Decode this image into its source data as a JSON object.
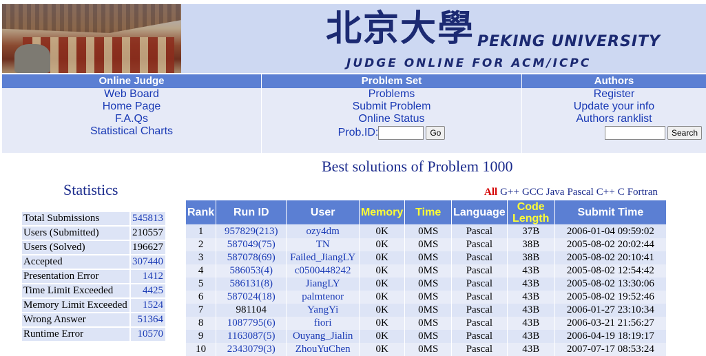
{
  "banner": {
    "chinese": "北京大學",
    "english": "PEKING  UNIVERSITY",
    "subtitle": "JUDGE ONLINE FOR ACM/ICPC"
  },
  "nav": {
    "online_judge": {
      "header": "Online Judge",
      "links": [
        "Web Board",
        "Home Page",
        "F.A.Qs",
        "Statistical Charts"
      ]
    },
    "problem_set": {
      "header": "Problem Set",
      "links": [
        "Problems",
        "Submit Problem",
        "Online Status"
      ],
      "probid_label": "Prob.ID:",
      "go_label": "Go"
    },
    "authors": {
      "header": "Authors",
      "links": [
        "Register",
        "Update your info",
        "Authors ranklist"
      ],
      "search_label": "Search"
    }
  },
  "title": {
    "text": "Best solutions of Problem ",
    "problem_id": "1000"
  },
  "statistics": {
    "heading": "Statistics",
    "rows": [
      {
        "label": "Total Submissions",
        "value": "545813",
        "link": true
      },
      {
        "label": "Users (Submitted)",
        "value": "210557",
        "link": false
      },
      {
        "label": "Users (Solved)",
        "value": "196627",
        "link": false
      },
      {
        "label": "Accepted",
        "value": "307440",
        "link": true
      },
      {
        "label": "Presentation Error",
        "value": "1412",
        "link": true
      },
      {
        "label": "Time Limit Exceeded",
        "value": "4425",
        "link": true
      },
      {
        "label": "Memory Limit Exceeded",
        "value": "1524",
        "link": true
      },
      {
        "label": "Wrong Answer",
        "value": "51364",
        "link": true
      },
      {
        "label": "Runtime Error",
        "value": "10570",
        "link": true
      }
    ]
  },
  "filters": [
    "All",
    "G++",
    "GCC",
    "Java",
    "Pascal",
    "C++",
    "C",
    "Fortran"
  ],
  "ranking": {
    "headers": [
      "Rank",
      "Run ID",
      "User",
      "Memory",
      "Time",
      "Language",
      "Code Length",
      "Submit Time"
    ],
    "rows": [
      [
        "1",
        "957829(213)",
        "ozy4dm",
        "0K",
        "0MS",
        "Pascal",
        "37B",
        "2006-01-04 09:59:02"
      ],
      [
        "2",
        "587049(75)",
        "TN",
        "0K",
        "0MS",
        "Pascal",
        "38B",
        "2005-08-02 20:02:44"
      ],
      [
        "3",
        "587078(69)",
        "Failed_JiangLY",
        "0K",
        "0MS",
        "Pascal",
        "38B",
        "2005-08-02 20:10:41"
      ],
      [
        "4",
        "586053(4)",
        "c0500448242",
        "0K",
        "0MS",
        "Pascal",
        "43B",
        "2005-08-02 12:54:42"
      ],
      [
        "5",
        "586131(8)",
        "JiangLY",
        "0K",
        "0MS",
        "Pascal",
        "43B",
        "2005-08-02 13:30:06"
      ],
      [
        "6",
        "587024(18)",
        "palmtenor",
        "0K",
        "0MS",
        "Pascal",
        "43B",
        "2005-08-02 19:52:46"
      ],
      [
        "7",
        "981104",
        "YangYi",
        "0K",
        "0MS",
        "Pascal",
        "43B",
        "2006-01-27 23:10:34"
      ],
      [
        "8",
        "1087795(6)",
        "fiori",
        "0K",
        "0MS",
        "Pascal",
        "43B",
        "2006-03-21 21:56:27"
      ],
      [
        "9",
        "1163087(5)",
        "Ouyang_Jialin",
        "0K",
        "0MS",
        "Pascal",
        "43B",
        "2006-04-19 18:19:17"
      ],
      [
        "10",
        "2343079(3)",
        "ZhouYuChen",
        "0K",
        "0MS",
        "Pascal",
        "43B",
        "2007-07-17 08:53:24"
      ]
    ],
    "run_id_linked": [
      true,
      true,
      true,
      true,
      true,
      true,
      false,
      true,
      true,
      true
    ]
  }
}
